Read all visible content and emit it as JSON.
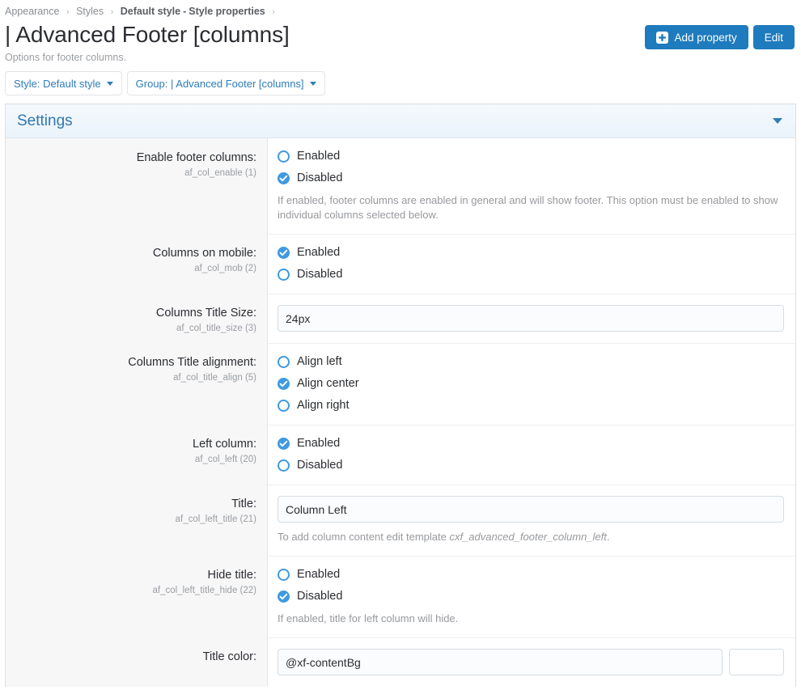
{
  "breadcrumb": {
    "items": [
      {
        "label": "Appearance",
        "strong": false
      },
      {
        "label": "Styles",
        "strong": false
      }
    ],
    "current_style": "Default style",
    "current_section": "Style properties",
    "dash": "-"
  },
  "header": {
    "title": "| Advanced Footer [columns]",
    "description": "Options for footer columns.",
    "add_property_label": "Add property",
    "edit_label": "Edit",
    "accent_color": "#1e7bbd"
  },
  "filters": {
    "style_filter": "Style: Default style",
    "group_filter": "Group: | Advanced Footer [columns]"
  },
  "settings_section": {
    "title": "Settings",
    "collapsed": false
  },
  "rows": [
    {
      "label": "Enable footer columns:",
      "code": "af_col_enable (1)",
      "type": "radio",
      "options": [
        {
          "label": "Enabled",
          "selected": false
        },
        {
          "label": "Disabled",
          "selected": true
        }
      ],
      "help": "If enabled, footer columns are enabled in general and will show footer. This option must be enabled to show individual columns selected below."
    },
    {
      "label": "Columns on mobile:",
      "code": "af_col_mob (2)",
      "type": "radio",
      "options": [
        {
          "label": "Enabled",
          "selected": true
        },
        {
          "label": "Disabled",
          "selected": false
        }
      ],
      "help": ""
    },
    {
      "label": "Columns Title Size:",
      "code": "af_col_title_size (3)",
      "type": "text",
      "value": "24px",
      "help": ""
    },
    {
      "label": "Columns Title alignment:",
      "code": "af_col_title_align (5)",
      "type": "radio",
      "options": [
        {
          "label": "Align left",
          "selected": false
        },
        {
          "label": "Align center",
          "selected": true
        },
        {
          "label": "Align right",
          "selected": false
        }
      ],
      "help": ""
    },
    {
      "label": "Left column:",
      "code": "af_col_left (20)",
      "type": "radio",
      "options": [
        {
          "label": "Enabled",
          "selected": true
        },
        {
          "label": "Disabled",
          "selected": false
        }
      ],
      "help": ""
    },
    {
      "label": "Title:",
      "code": "af_col_left_title (21)",
      "type": "text",
      "value": "Column Left",
      "help_prefix": "To add column content edit template ",
      "help_em": "cxf_advanced_footer_column_left",
      "help_suffix": "."
    },
    {
      "label": "Hide title:",
      "code": "af_col_left_title_hide (22)",
      "type": "radio",
      "options": [
        {
          "label": "Enabled",
          "selected": false
        },
        {
          "label": "Disabled",
          "selected": true
        }
      ],
      "help": "If enabled, title for left column will hide."
    },
    {
      "label": "Title color:",
      "code": "",
      "type": "color",
      "value": "@xf-contentBg",
      "swatch_color": "#ffffff",
      "help": ""
    }
  ]
}
